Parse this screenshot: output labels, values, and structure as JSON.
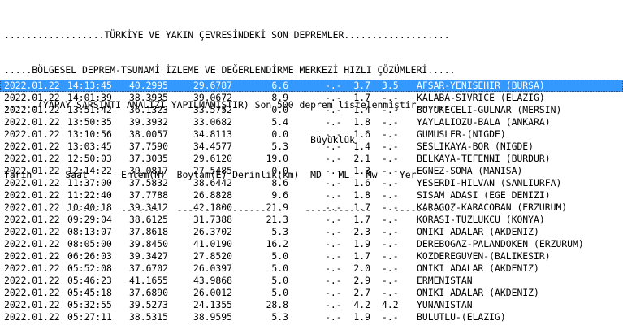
{
  "header": {
    "line1": "..................TÜRKİYE VE YAKIN ÇEVRESİNDEKİ SON DEPREMLER...................",
    "line2": ".....BÖLGESEL DEPREM-TSUNAMİ İZLEME VE DEĞERLENDİRME MERKEZİ HIZLI ÇÖZÜMLERİ.....",
    "line3": "......(YAPAY SARSINTI ANALİZİ YAPILMAMIŞTIR) Son 500 deprem listelenmiştir......",
    "line4": "                                                       Büyüklük",
    "columns": "Tarih      Saat      Enlem(N)  Boylam(E) Derinlik(km)  MD   ML   Mw    Yer",
    "separator": "---------- --------  --------  -------  ----------    ------------    -----------"
  },
  "rows": [
    {
      "date": "2022.01.22",
      "time": "14:13:45",
      "lat": "40.2995",
      "lon": "29.6787",
      "depth": "6.6",
      "md": "-.-",
      "ml": "3.7",
      "mw": "3.5",
      "location": "AFSAR-YENISEHIR (BURSA)",
      "selected": true
    },
    {
      "date": "2022.01.22",
      "time": "14:01:39",
      "lat": "38.3935",
      "lon": "39.0672",
      "depth": "8.9",
      "md": "-.-",
      "ml": "1.7",
      "mw": "-.-",
      "location": "KALABA-SIVRICE (ELAZIG)"
    },
    {
      "date": "2022.01.22",
      "time": "13:51:42",
      "lat": "36.1323",
      "lon": "33.5752",
      "depth": "0.0",
      "md": "-.-",
      "ml": "1.4",
      "mw": "-.-",
      "location": "BUYUKECELI-GULNAR (MERSIN)"
    },
    {
      "date": "2022.01.22",
      "time": "13:50:35",
      "lat": "39.3932",
      "lon": "33.0682",
      "depth": "5.4",
      "md": "-.-",
      "ml": "1.8",
      "mw": "-.-",
      "location": "YAYLALIOZU-BALA (ANKARA)"
    },
    {
      "date": "2022.01.22",
      "time": "13:10:56",
      "lat": "38.0057",
      "lon": "34.8113",
      "depth": "0.0",
      "md": "-.-",
      "ml": "1.6",
      "mw": "-.-",
      "location": "GUMUSLER-(NIGDE)"
    },
    {
      "date": "2022.01.22",
      "time": "13:03:45",
      "lat": "37.7590",
      "lon": "34.4577",
      "depth": "5.3",
      "md": "-.-",
      "ml": "1.4",
      "mw": "-.-",
      "location": "SESLIKAYA-BOR (NIGDE)"
    },
    {
      "date": "2022.01.22",
      "time": "12:50:03",
      "lat": "37.3035",
      "lon": "29.6120",
      "depth": "19.0",
      "md": "-.-",
      "ml": "2.1",
      "mw": "-.-",
      "location": "BELKAYA-TEFENNI (BURDUR)"
    },
    {
      "date": "2022.01.22",
      "time": "12:14:22",
      "lat": "39.0817",
      "lon": "27.5485",
      "depth": "0.0",
      "md": "-.-",
      "ml": "1.3",
      "mw": "-.-",
      "location": "EGNEZ-SOMA (MANISA)"
    },
    {
      "date": "2022.01.22",
      "time": "11:37:00",
      "lat": "37.5832",
      "lon": "38.6442",
      "depth": "8.6",
      "md": "-.-",
      "ml": "1.6",
      "mw": "-.-",
      "location": "YESERDI-HILVAN (SANLIURFA)"
    },
    {
      "date": "2022.01.22",
      "time": "11:22:40",
      "lat": "37.7788",
      "lon": "26.8828",
      "depth": "9.6",
      "md": "-.-",
      "ml": "1.8",
      "mw": "-.-",
      "location": "SISAM ADASI (EGE DENIZI)"
    },
    {
      "date": "2022.01.22",
      "time": "10:40:18",
      "lat": "39.3412",
      "lon": "42.1800",
      "depth": "21.9",
      "md": "-.-",
      "ml": "1.7",
      "mw": "-.-",
      "location": "KARAGOZ-KARACOBAN (ERZURUM)"
    },
    {
      "date": "2022.01.22",
      "time": "09:29:04",
      "lat": "38.6125",
      "lon": "31.7388",
      "depth": "21.3",
      "md": "-.-",
      "ml": "1.7",
      "mw": "-.-",
      "location": "KORASI-TUZLUKCU (KONYA)"
    },
    {
      "date": "2022.01.22",
      "time": "08:13:07",
      "lat": "37.8618",
      "lon": "26.3702",
      "depth": "5.3",
      "md": "-.-",
      "ml": "2.3",
      "mw": "-.-",
      "location": "ONIKI ADALAR (AKDENIZ)"
    },
    {
      "date": "2022.01.22",
      "time": "08:05:00",
      "lat": "39.8450",
      "lon": "41.0190",
      "depth": "16.2",
      "md": "-.-",
      "ml": "1.9",
      "mw": "-.-",
      "location": "DEREBOGAZ-PALANDOKEN (ERZURUM)"
    },
    {
      "date": "2022.01.22",
      "time": "06:26:03",
      "lat": "39.3427",
      "lon": "27.8520",
      "depth": "5.0",
      "md": "-.-",
      "ml": "1.7",
      "mw": "-.-",
      "location": "KOZDEREGUVEN-(BALIKESIR)"
    },
    {
      "date": "2022.01.22",
      "time": "05:52:08",
      "lat": "37.6702",
      "lon": "26.0397",
      "depth": "5.0",
      "md": "-.-",
      "ml": "2.0",
      "mw": "-.-",
      "location": "ONIKI ADALAR (AKDENIZ)"
    },
    {
      "date": "2022.01.22",
      "time": "05:46:23",
      "lat": "41.1655",
      "lon": "43.9868",
      "depth": "5.0",
      "md": "-.-",
      "ml": "2.9",
      "mw": "-.-",
      "location": "ERMENISTAN"
    },
    {
      "date": "2022.01.22",
      "time": "05:45:18",
      "lat": "37.6890",
      "lon": "26.0012",
      "depth": "5.0",
      "md": "-.-",
      "ml": "2.7",
      "mw": "-.-",
      "location": "ONIKI ADALAR (AKDENIZ)"
    },
    {
      "date": "2022.01.22",
      "time": "05:32:55",
      "lat": "39.5273",
      "lon": "24.1355",
      "depth": "28.8",
      "md": "-.-",
      "ml": "4.2",
      "mw": "4.2",
      "location": "YUNANISTAN"
    },
    {
      "date": "2022.01.22",
      "time": "05:27:11",
      "lat": "38.5315",
      "lon": "38.9595",
      "depth": "5.3",
      "md": "-.-",
      "ml": "1.9",
      "mw": "-.-",
      "location": "BULUTLU-(ELAZIG)"
    }
  ],
  "colors": {
    "selected_background": "#3399ff",
    "selected_text": "#ffffff",
    "text": "#000000",
    "background": "#ffffff"
  }
}
